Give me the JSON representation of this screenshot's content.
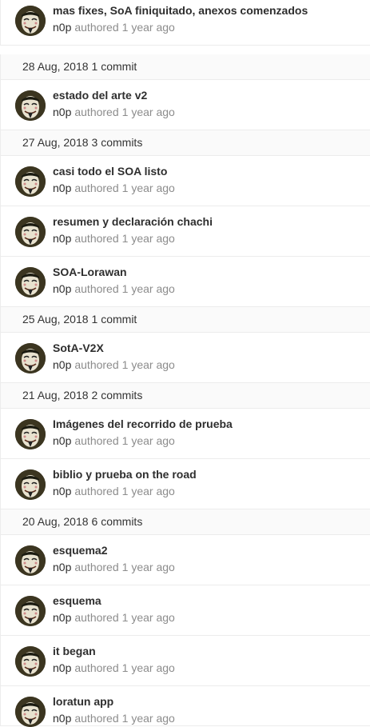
{
  "commits": [
    {
      "title": "mas fixes, SoA finiquitado, anexos comenzados",
      "author": "n0p",
      "verb": "authored",
      "time": "1 year ago"
    },
    {
      "title": "estado del arte v2",
      "author": "n0p",
      "verb": "authored",
      "time": "1 year ago"
    },
    {
      "title": "casi todo el SOA listo",
      "author": "n0p",
      "verb": "authored",
      "time": "1 year ago"
    },
    {
      "title": "resumen y declaración chachi",
      "author": "n0p",
      "verb": "authored",
      "time": "1 year ago"
    },
    {
      "title": "SOA-Lorawan",
      "author": "n0p",
      "verb": "authored",
      "time": "1 year ago"
    },
    {
      "title": "SotA-V2X",
      "author": "n0p",
      "verb": "authored",
      "time": "1 year ago"
    },
    {
      "title": "Imágenes del recorrido de prueba",
      "author": "n0p",
      "verb": "authored",
      "time": "1 year ago"
    },
    {
      "title": "biblio y prueba on the road",
      "author": "n0p",
      "verb": "authored",
      "time": "1 year ago"
    },
    {
      "title": "esquema2",
      "author": "n0p",
      "verb": "authored",
      "time": "1 year ago"
    },
    {
      "title": "esquema",
      "author": "n0p",
      "verb": "authored",
      "time": "1 year ago"
    },
    {
      "title": "it began",
      "author": "n0p",
      "verb": "authored",
      "time": "1 year ago"
    },
    {
      "title": "loratun app",
      "author": "n0p",
      "verb": "authored",
      "time": "1 year ago"
    }
  ],
  "dates": [
    {
      "date": "28 Aug, 2018",
      "count": "1 commit"
    },
    {
      "date": "27 Aug, 2018",
      "count": "3 commits"
    },
    {
      "date": "25 Aug, 2018",
      "count": "1 commit"
    },
    {
      "date": "21 Aug, 2018",
      "count": "2 commits"
    },
    {
      "date": "20 Aug, 2018",
      "count": "6 commits"
    }
  ],
  "colors": {
    "title": "#2e2e2e",
    "meta": "#8c8c8c",
    "date_row_bg": "#fafafa",
    "border": "#ececec"
  },
  "icons": {
    "avatar": "guy-fawkes-mask-avatar"
  }
}
